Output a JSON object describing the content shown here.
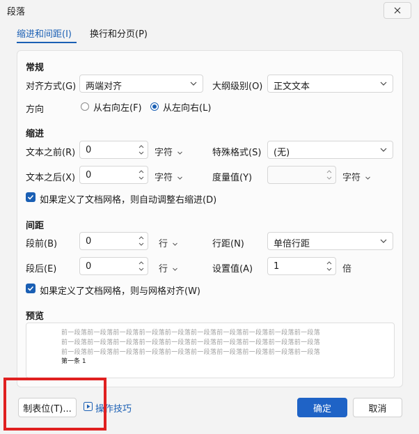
{
  "window": {
    "title": "段落",
    "close_icon": "close-icon"
  },
  "tabs": [
    {
      "label": "缩进和间距(I)",
      "active": true
    },
    {
      "label": "换行和分页(P)",
      "active": false
    }
  ],
  "general": {
    "heading": "常规",
    "alignment_label": "对齐方式(G)",
    "alignment_value": "两端对齐",
    "outline_label": "大纲级别(O)",
    "outline_value": "正文文本",
    "direction_label": "方向",
    "rtl_label": "从右向左(F)",
    "ltr_label": "从左向右(L)",
    "direction_selected": "ltr"
  },
  "indent": {
    "heading": "缩进",
    "before_label": "文本之前(R)",
    "before_value": "0",
    "before_unit": "字符",
    "special_label": "特殊格式(S)",
    "special_value": "(无)",
    "after_label": "文本之后(X)",
    "after_value": "0",
    "after_unit": "字符",
    "measure_label": "度量值(Y)",
    "measure_value": "",
    "measure_unit": "字符",
    "grid_checkbox_label": "如果定义了文档网格，则自动调整右缩进(D)",
    "grid_checked": true
  },
  "spacing": {
    "heading": "间距",
    "before_label": "段前(B)",
    "before_value": "0",
    "before_unit": "行",
    "line_label": "行距(N)",
    "line_value": "单倍行距",
    "after_label": "段后(E)",
    "after_value": "0",
    "after_unit": "行",
    "setting_label": "设置值(A)",
    "setting_value": "1",
    "setting_unit": "倍",
    "grid_checkbox_label": "如果定义了文档网格，则与网格对齐(W)",
    "grid_checked": true
  },
  "preview": {
    "heading": "预览",
    "prev_line_1": "前一段落前一段落前一段落前一段落前一段落前一段落前一段落前一段落前一段落前一段落",
    "prev_line_2": "前一段落前一段落前一段落前一段落前一段落前一段落前一段落前一段落前一段落前一段落",
    "prev_line_3": "前一段落前一段落前一段落前一段落前一段落前一段落前一段落前一段落前一段落前一段落",
    "sample_text": "第一条 1"
  },
  "footer": {
    "tabs_button": "制表位(T)...",
    "tips_link": "操作技巧",
    "ok_button": "确定",
    "cancel_button": "取消"
  },
  "colors": {
    "accent": "#1a5fb4",
    "primary_button": "#1f63c6",
    "highlight": "#e02020"
  }
}
